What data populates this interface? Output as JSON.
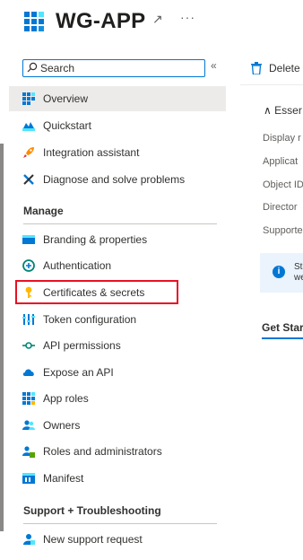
{
  "app": {
    "title": "WG-APP",
    "pin_icon": "pin-icon",
    "more_label": "···"
  },
  "search": {
    "placeholder": "Search",
    "collapse_label": "«"
  },
  "nav": {
    "top_items": [
      {
        "label": "Overview",
        "icon": "overview-icon",
        "selected": true
      },
      {
        "label": "Quickstart",
        "icon": "quickstart-icon"
      },
      {
        "label": "Integration assistant",
        "icon": "rocket-icon"
      },
      {
        "label": "Diagnose and solve problems",
        "icon": "wrench-icon"
      }
    ],
    "manage": {
      "heading": "Manage",
      "items": [
        {
          "label": "Branding & properties",
          "icon": "branding-icon"
        },
        {
          "label": "Authentication",
          "icon": "authentication-icon"
        },
        {
          "label": "Certificates & secrets",
          "icon": "key-icon",
          "highlighted": true
        },
        {
          "label": "Token configuration",
          "icon": "token-icon"
        },
        {
          "label": "API permissions",
          "icon": "api-permissions-icon"
        },
        {
          "label": "Expose an API",
          "icon": "cloud-icon"
        },
        {
          "label": "App roles",
          "icon": "app-roles-icon"
        },
        {
          "label": "Owners",
          "icon": "owners-icon"
        },
        {
          "label": "Roles and administrators",
          "icon": "roles-admin-icon"
        },
        {
          "label": "Manifest",
          "icon": "manifest-icon"
        }
      ]
    },
    "support": {
      "heading": "Support + Troubleshooting",
      "items": [
        {
          "label": "New support request",
          "icon": "support-icon"
        }
      ]
    }
  },
  "main": {
    "toolbar": {
      "delete_label": "Delete"
    },
    "essentials_label": "Esser",
    "essentials_rows": [
      "Display r",
      "Applicat",
      "Object ID",
      "Director",
      "Supporte"
    ],
    "info": {
      "line1": "Sta",
      "line2": "we"
    },
    "get_started_label": "Get Star"
  },
  "colors": {
    "accent": "#0078d4",
    "highlight_border": "#e81123",
    "selected_bg": "#edebe9"
  }
}
